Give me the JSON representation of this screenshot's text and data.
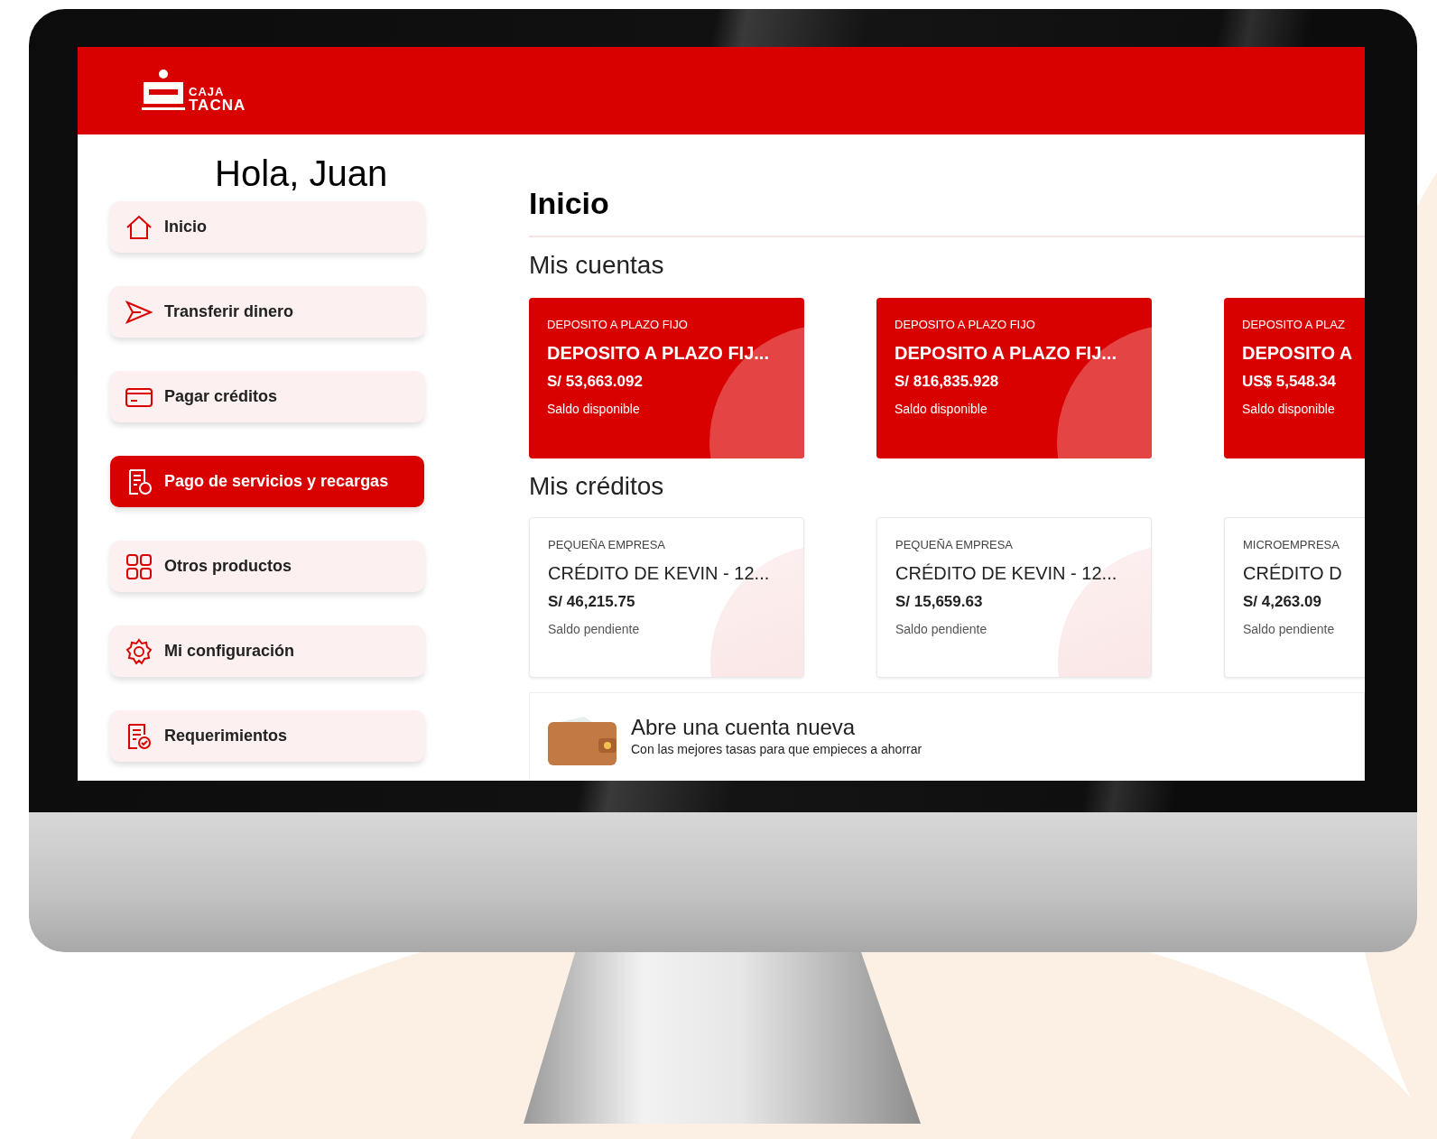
{
  "header": {
    "logo_text": [
      "CAJA",
      "TACNA"
    ]
  },
  "sidebar": {
    "greeting": "Hola, Juan",
    "items": [
      {
        "label": "Inicio",
        "selected": false
      },
      {
        "label": "Transferir dinero",
        "selected": false
      },
      {
        "label": "Pagar créditos",
        "selected": false
      },
      {
        "label": "Pago de servicios y recargas",
        "selected": true
      },
      {
        "label": "Otros productos",
        "selected": false
      },
      {
        "label": "Mi configuración",
        "selected": false
      },
      {
        "label": "Requerimientos",
        "selected": false
      }
    ]
  },
  "main": {
    "title": "Inicio",
    "accounts": {
      "heading": "Mis cuentas",
      "cards": [
        {
          "type": "DEPOSITO A PLAZO FIJO",
          "name": "DEPOSITO A PLAZO FIJ...",
          "amount": "S/ 53,663.092",
          "caption": "Saldo disponible"
        },
        {
          "type": "DEPOSITO A PLAZO FIJO",
          "name": "DEPOSITO A PLAZO FIJ...",
          "amount": "S/ 816,835.928",
          "caption": "Saldo disponible"
        },
        {
          "type": "DEPOSITO A PLAZ",
          "name": "DEPOSITO A",
          "amount": "US$ 5,548.34",
          "caption": "Saldo disponible"
        }
      ]
    },
    "credits": {
      "heading": "Mis créditos",
      "cards": [
        {
          "type": "PEQUEÑA EMPRESA",
          "name": "CRÉDITO DE KEVIN - 12...",
          "amount": "S/ 46,215.75",
          "caption": "Saldo pendiente"
        },
        {
          "type": "PEQUEÑA EMPRESA",
          "name": "CRÉDITO DE KEVIN - 12...",
          "amount": "S/ 15,659.63",
          "caption": "Saldo pendiente"
        },
        {
          "type": "MICROEMPRESA",
          "name": "CRÉDITO D",
          "amount": "S/ 4,263.09",
          "caption": "Saldo pendiente"
        }
      ]
    },
    "promo": {
      "title": "Abre una cuenta nueva",
      "text": "Con las mejores tasas para que empieces a ahorrar"
    }
  }
}
